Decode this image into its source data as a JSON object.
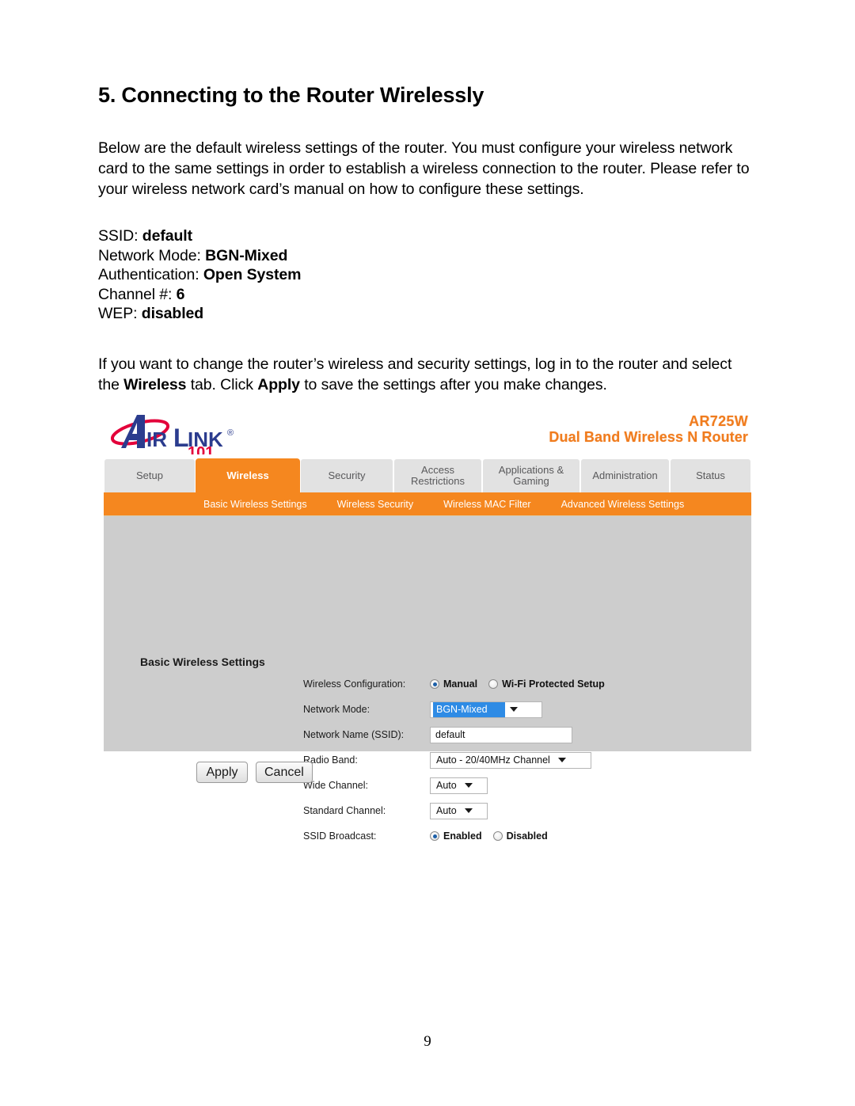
{
  "document": {
    "heading": "5. Connecting to the Router Wirelessly",
    "intro_paragraph": "Below are the default wireless settings of the router. You must configure your wireless network card to the same settings in order to establish a wireless connection to the router. Please refer to your wireless network card’s manual on how to configure these settings.",
    "default_settings": [
      {
        "label": "SSID:",
        "value": "default"
      },
      {
        "label": "Network Mode:",
        "value": "BGN-Mixed"
      },
      {
        "label": "Authentication:",
        "value": "Open System"
      },
      {
        "label": "Channel #:",
        "value": "6"
      },
      {
        "label": "WEP:",
        "value": "disabled"
      }
    ],
    "closing_paragraph": {
      "part1": "If you want to change the router’s wireless and security settings, log in to the router and select the ",
      "bold1": "Wireless",
      "part2": " tab.  Click ",
      "bold2": "Apply",
      "part3": " to save the settings after you make changes."
    },
    "page_number": "9"
  },
  "router_ui": {
    "brand": {
      "name_part1": "A",
      "name_part2": "IR",
      "name_part3": "L",
      "name_part4": "INK",
      "registered": "®",
      "suffix": "101",
      "logo_blue": "#2B3C8E",
      "logo_red": "#E3003A"
    },
    "model": {
      "name": "AR725W",
      "description": "Dual Band Wireless N Router",
      "color": "#F07C1E"
    },
    "tabs": [
      {
        "label": "Setup",
        "active": false
      },
      {
        "label": "Wireless",
        "active": true
      },
      {
        "label": "Security",
        "active": false
      },
      {
        "label": "Access Restrictions",
        "active": false
      },
      {
        "label": "Applications & Gaming",
        "active": false
      },
      {
        "label": "Administration",
        "active": false
      },
      {
        "label": "Status",
        "active": false
      }
    ],
    "subtabs": [
      "Basic Wireless Settings",
      "Wireless Security",
      "Wireless MAC Filter",
      "Advanced Wireless Settings"
    ],
    "panel_heading": "Basic Wireless Settings",
    "fields": {
      "wireless_configuration": {
        "label": "Wireless Configuration:",
        "option_manual": "Manual",
        "option_wps": "Wi-Fi Protected Setup",
        "selected": "Manual"
      },
      "network_mode": {
        "label": "Network Mode:",
        "value": "BGN-Mixed"
      },
      "network_name": {
        "label": "Network Name (SSID):",
        "value": "default"
      },
      "radio_band": {
        "label": "Radio Band:",
        "value": "Auto - 20/40MHz Channel"
      },
      "wide_channel": {
        "label": "Wide Channel:",
        "value": "Auto"
      },
      "standard_channel": {
        "label": "Standard Channel:",
        "value": "Auto"
      },
      "ssid_broadcast": {
        "label": "SSID Broadcast:",
        "option_enabled": "Enabled",
        "option_disabled": "Disabled",
        "selected": "Enabled"
      }
    },
    "buttons": {
      "apply": "Apply",
      "cancel": "Cancel"
    },
    "colors": {
      "accent_orange": "#F5871F",
      "panel_grey": "#CDCDCD",
      "tab_grey": "#E2E2E2",
      "select_highlight": "#2E8BE5"
    }
  }
}
